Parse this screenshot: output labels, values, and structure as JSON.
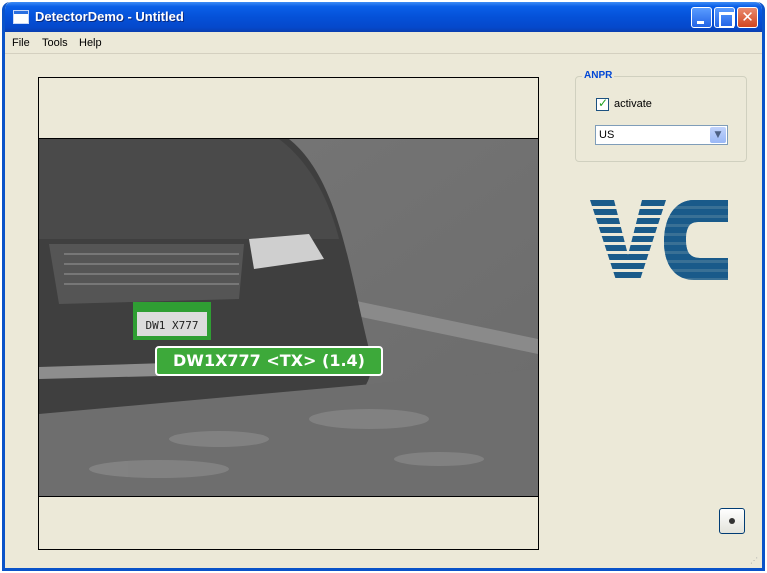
{
  "window": {
    "title": "DetectorDemo - Untitled"
  },
  "menu": [
    "File",
    "Tools",
    "Help"
  ],
  "video": {
    "detection_label": "DW1X777 <TX> (1.4)",
    "plate_text": "DW1 X777"
  },
  "anpr": {
    "legend": "ANPR",
    "activate_label": "activate",
    "activate_checked": true,
    "region_value": "US"
  },
  "colors": {
    "titlebar": "#0551d8",
    "detection": "#3da93a",
    "logo": "#1a5b8a"
  },
  "icons": {
    "record": "record-icon",
    "logo": "vc-logo"
  }
}
